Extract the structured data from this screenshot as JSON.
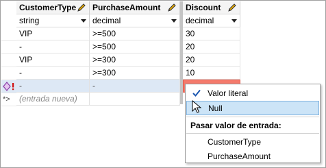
{
  "columns": [
    {
      "header": "CustomerType",
      "type": "string"
    },
    {
      "header": "PurchaseAmount",
      "type": "decimal"
    },
    {
      "header": "Discount",
      "type": "decimal"
    }
  ],
  "rows": [
    {
      "c1": "VIP",
      "c2": ">=500",
      "c3": "30"
    },
    {
      "c1": "-",
      "c2": ">=500",
      "c3": "20"
    },
    {
      "c1": "VIP",
      "c2": ">=300",
      "c3": "20"
    },
    {
      "c1": "-",
      "c2": ">=300",
      "c3": "10"
    }
  ],
  "selected_row": {
    "c1": "-",
    "c2": "-"
  },
  "new_row": {
    "marker": "*>",
    "placeholder": "(entrada nueva)"
  },
  "menu": {
    "items": [
      {
        "label": "Valor literal",
        "checked": true
      },
      {
        "label": "Null",
        "highlighted": true
      }
    ],
    "section_title": "Pasar valor de entrada:",
    "inputs": [
      "CustomerType",
      "PurchaseAmount"
    ]
  },
  "icons": {
    "edit": "pencil-icon",
    "dropdown": "chevron-down-icon",
    "row_error": "diamond-error-icon",
    "check": "check-icon",
    "cursor": "mouse-pointer-icon"
  },
  "colors": {
    "error_cell": "#f47a6c",
    "selection": "#dde8f5",
    "menu_highlight": "#cce4f7",
    "check_blue": "#1a56b0"
  }
}
